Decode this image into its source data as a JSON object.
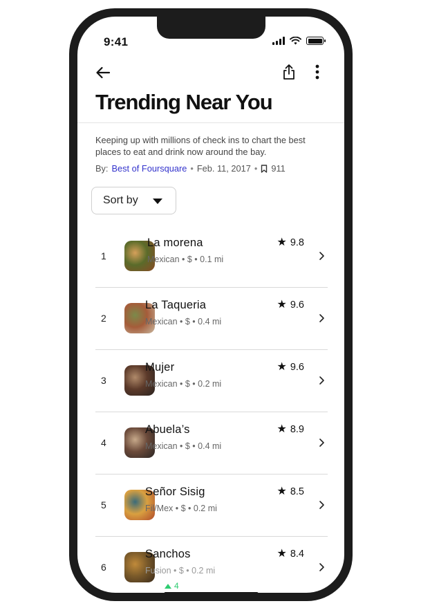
{
  "status_bar": {
    "time": "9:41"
  },
  "header": {
    "title": "Trending Near You"
  },
  "article": {
    "description": "Keeping up with millions of check ins to chart the best places to eat and drink now around the bay.",
    "by_label": "By:",
    "author": "Best of Foursquare",
    "date": "Feb. 11, 2017",
    "saves": "911"
  },
  "sort": {
    "label": "Sort by"
  },
  "places": [
    {
      "rank": "1",
      "name": "La morena",
      "details": "Mexican • $ • 0.1 mi",
      "rating": "9.8",
      "thumb_colors": [
        "#8a4a25",
        "#d6a05a",
        "#5a6b2a"
      ]
    },
    {
      "rank": "2",
      "name": "La Taqueria",
      "details": "Mexican • $ • 0.4 mi",
      "rating": "9.6",
      "thumb_colors": [
        "#c9b8a0",
        "#7b8a4a",
        "#a55c3a"
      ]
    },
    {
      "rank": "3",
      "name": "Mujer",
      "details": "Mexican • $ • 0.2 mi",
      "rating": "9.6",
      "thumb_colors": [
        "#2a2320",
        "#b08a6a",
        "#5c3a2a"
      ]
    },
    {
      "rank": "4",
      "name": "Abuela’s",
      "details": "Mexican • $ • 0.4 mi",
      "rating": "8.9",
      "thumb_colors": [
        "#2a2524",
        "#c7a98a",
        "#6b4a3a"
      ]
    },
    {
      "rank": "5",
      "name": "Señor Sisig",
      "details": "Fil/Mex • $ • 0.2 mi",
      "rating": "8.5",
      "thumb_colors": [
        "#b04a2a",
        "#3a6b7a",
        "#d9a040"
      ]
    },
    {
      "rank": "6",
      "name": "Sanchos",
      "details": "Fusion • $ • 0.2 mi",
      "rating": "8.4",
      "thumb_colors": [
        "#3a2a1a",
        "#c08a3a",
        "#7a5a2a"
      ]
    }
  ],
  "trend": {
    "value": "4"
  },
  "colors": {
    "author_link": "#3333cc",
    "trend_up": "#2ecc71",
    "frame": "#1c1c1c"
  },
  "icons": [
    "back-arrow-icon",
    "share-icon",
    "more-vertical-icon",
    "bookmark-icon",
    "sort-caret-icon",
    "star-icon",
    "chevron-right-icon",
    "wifi-icon",
    "signal-icon",
    "battery-icon",
    "trend-up-icon"
  ]
}
